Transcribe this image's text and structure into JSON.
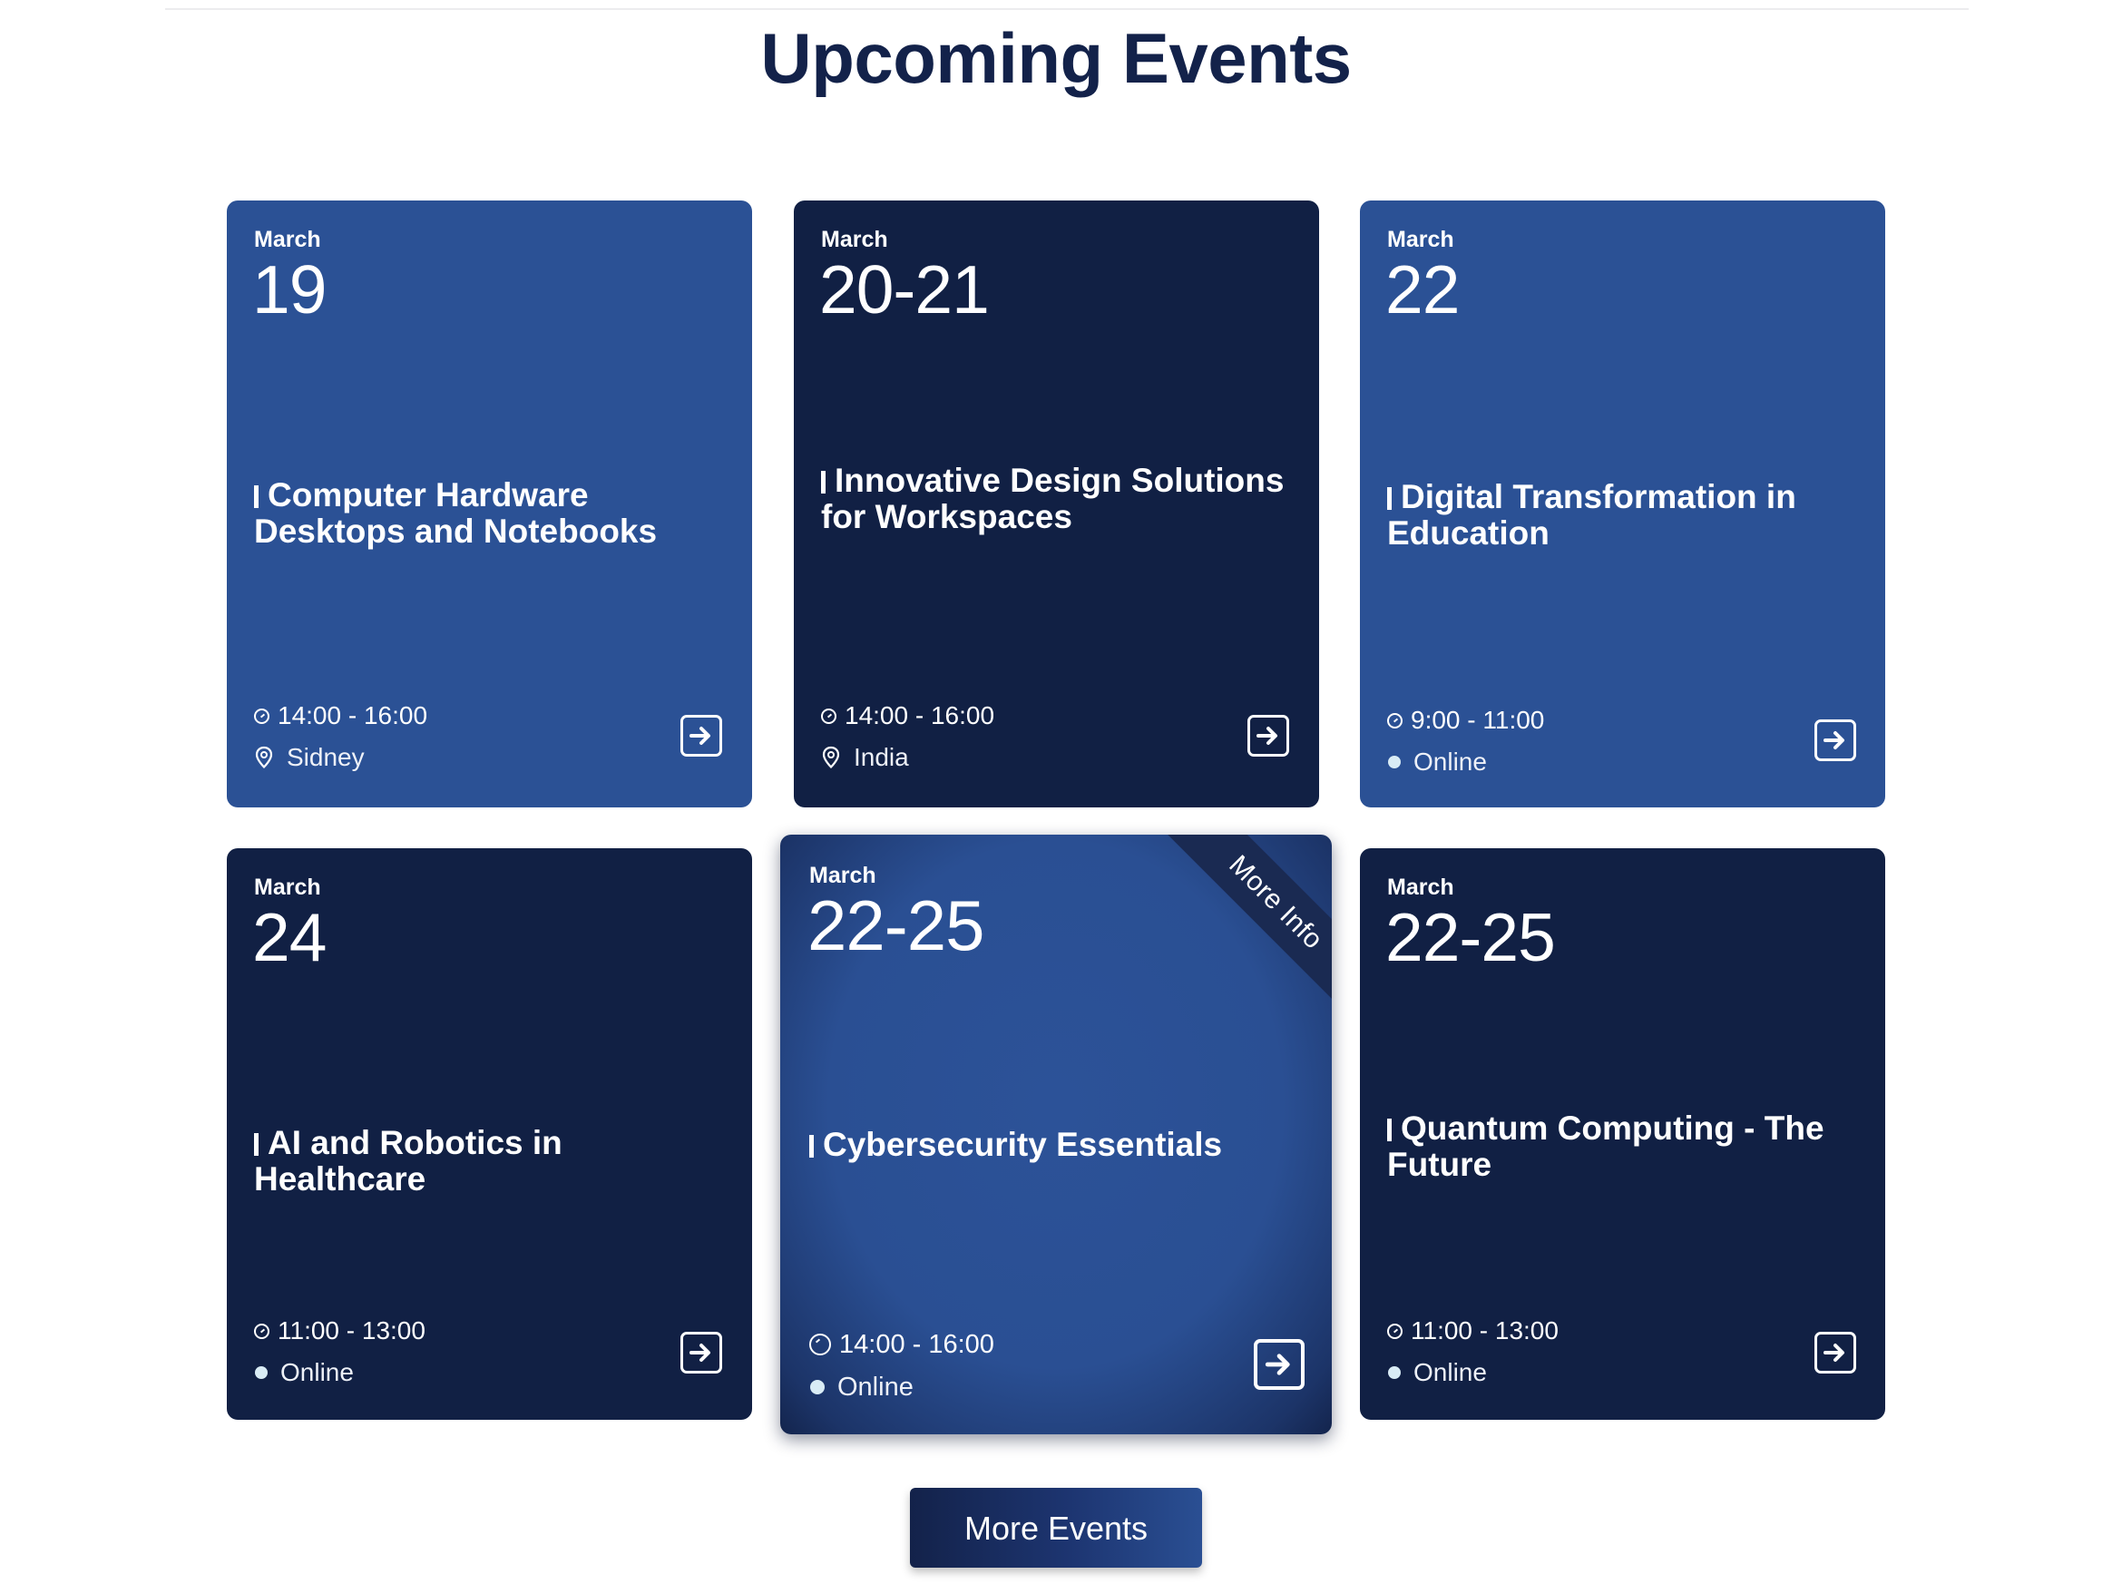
{
  "page": {
    "title": "Upcoming Events"
  },
  "events": [
    {
      "month": "March",
      "day": "19",
      "title": "Computer Hardware Desktops and Notebooks",
      "time": "14:00 - 16:00",
      "location": "Sidney",
      "location_icon": "map-pin-icon",
      "theme": "blue"
    },
    {
      "month": "March",
      "day": "20-21",
      "title": "Innovative Design Solutions for Workspaces",
      "time": "14:00 - 16:00",
      "location": "India",
      "location_icon": "map-pin-icon",
      "theme": "navy"
    },
    {
      "month": "March",
      "day": "22",
      "title": "Digital Transformation in Education",
      "time": "9:00 - 11:00",
      "location": "Online",
      "location_icon": "online-dot-icon",
      "theme": "blue"
    },
    {
      "month": "March",
      "day": "24",
      "title": "AI and Robotics in Healthcare",
      "time": "11:00 - 13:00",
      "location": "Online",
      "location_icon": "online-dot-icon",
      "theme": "navy"
    },
    {
      "month": "March",
      "day": "22-25",
      "title": "Cybersecurity Essentials",
      "time": "14:00 - 16:00",
      "location": "Online",
      "location_icon": "online-dot-icon",
      "theme": "featured",
      "ribbon": "More Info"
    },
    {
      "month": "March",
      "day": "22-25",
      "title": "Quantum Computing - The Future",
      "time": "11:00 - 13:00",
      "location": "Online",
      "location_icon": "online-dot-icon",
      "theme": "navy"
    }
  ],
  "more_button": {
    "label": "More Events"
  },
  "colors": {
    "card_blue": "#2b5195",
    "card_navy": "#112044",
    "heading": "#13224a",
    "online_dot": "#d9ecf5"
  }
}
